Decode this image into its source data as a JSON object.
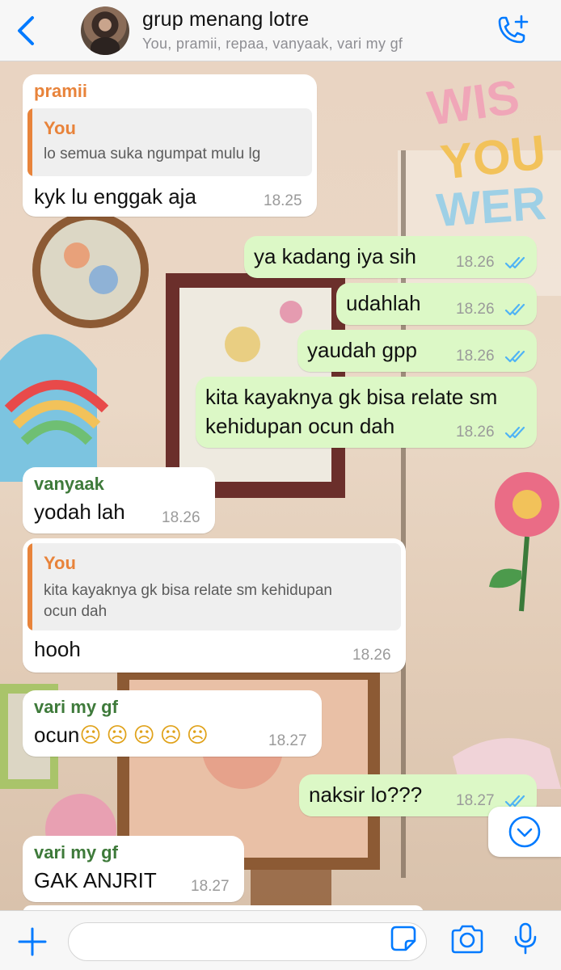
{
  "header": {
    "title": "grup menang lotre",
    "subtitle": "You, pramii, repaa, vanyaak, vari my gf"
  },
  "colors": {
    "accent": "#007aff",
    "outgoing_bubble": "#dcf8c6",
    "incoming_bubble": "#ffffff",
    "you_name": "#e8833a",
    "pramii_name": "#e8833a",
    "vanyaak_name": "#3e7a3a",
    "vari_name": "#3e7a3a",
    "read_ticks": "#4fb3f5"
  },
  "messages": [
    {
      "sender": "pramii",
      "quote": {
        "name": "You",
        "text": "lo semua suka ngumpat mulu lg"
      },
      "text": "kyk lu enggak aja",
      "time": "18.25"
    },
    {
      "text": "ya kadang iya sih",
      "time": "18.26",
      "ticks": "double-check-icon"
    },
    {
      "text": "udahlah",
      "time": "18.26",
      "ticks": "double-check-icon"
    },
    {
      "text": "yaudah gpp",
      "time": "18.26",
      "ticks": "double-check-icon"
    },
    {
      "text_line1": "kita kayaknya gk bisa relate sm",
      "text_line2": "kehidupan ocun dah",
      "time": "18.26",
      "ticks": "double-check-icon"
    },
    {
      "sender": "vanyaak",
      "text": "yodah lah",
      "time": "18.26"
    },
    {
      "quote": {
        "name": "You",
        "text_line1": "kita kayaknya gk bisa relate sm kehidupan",
        "text_line2": "ocun dah"
      },
      "text": "hooh",
      "time": "18.26"
    },
    {
      "sender": "vari my gf",
      "text": "ocun",
      "emoji": "☹☹☹☹☹",
      "time": "18.27"
    },
    {
      "text": "naksir lo???",
      "time": "18.27",
      "ticks": "double-check-icon"
    },
    {
      "sender": "vari my gf",
      "text": "GAK ANJRIT",
      "time": "18.27"
    }
  ],
  "input": {
    "placeholder": ""
  }
}
